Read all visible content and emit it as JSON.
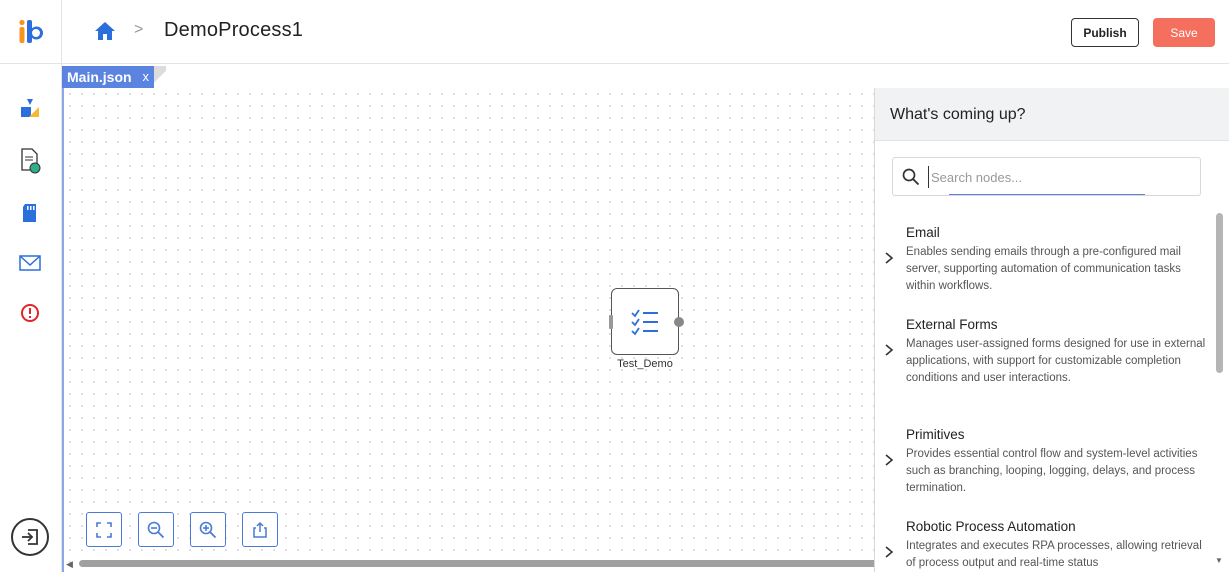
{
  "header": {
    "breadcrumb_title": "DemoProcess1",
    "breadcrumb_sep": ">",
    "publish_label": "Publish",
    "save_label": "Save"
  },
  "colors": {
    "accent": "#5b84e0",
    "save": "#f56f5f",
    "logo_orange": "#f7941d",
    "logo_blue": "#2a6fdb",
    "alert_red": "#e0262a"
  },
  "sidebar": {
    "items": [
      {
        "icon": "workflow-icon"
      },
      {
        "icon": "document-settings-icon"
      },
      {
        "icon": "sd-card-icon"
      },
      {
        "icon": "mail-icon"
      },
      {
        "icon": "alert-icon"
      }
    ],
    "exit_icon": "logout-icon"
  },
  "editor": {
    "tab_label": "Main.json",
    "tab_close": "x",
    "node": {
      "label": "Test_Demo",
      "icon": "checklist-icon"
    },
    "controls": [
      "fit-view-icon",
      "zoom-out-icon",
      "zoom-in-icon",
      "export-icon"
    ]
  },
  "panel": {
    "title": "What's coming up?",
    "search_placeholder": "Search nodes...",
    "items": [
      {
        "title": "Email",
        "desc": "Enables sending emails through a pre-configured mail server, supporting automation of communication tasks within workflows."
      },
      {
        "title": "External Forms",
        "desc": "Manages user-assigned forms designed for use in external applications, with support for customizable completion conditions and user interactions."
      },
      {
        "title": "Primitives",
        "desc": "Provides essential control flow and system-level activities such as branching, looping, logging, delays, and process termination."
      },
      {
        "title": "Robotic Process Automation",
        "desc": "Integrates and executes RPA processes, allowing retrieval of process output and real-time status"
      }
    ]
  }
}
